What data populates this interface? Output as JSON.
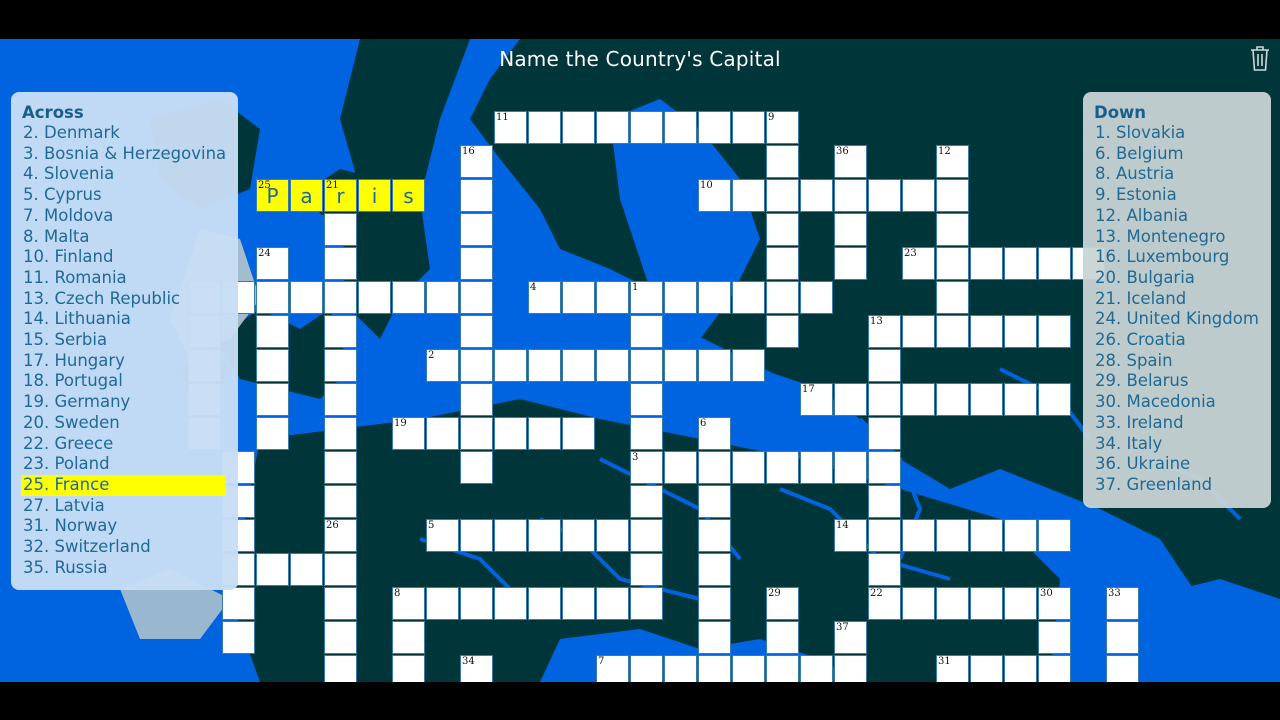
{
  "title": "Name the Country's Capital",
  "toolbar": {
    "trash_icon": "trash-icon"
  },
  "colors": {
    "sea": "#0063e0",
    "land": "#00353a",
    "highlight": "#ffff00",
    "clue_text": "#1f6a95"
  },
  "across": {
    "heading": "Across",
    "clues": [
      {
        "num": 2,
        "text": "2. Denmark"
      },
      {
        "num": 3,
        "text": "3. Bosnia & Herzegovina"
      },
      {
        "num": 4,
        "text": "4. Slovenia"
      },
      {
        "num": 5,
        "text": "5. Cyprus"
      },
      {
        "num": 7,
        "text": "7. Moldova"
      },
      {
        "num": 8,
        "text": "8. Malta"
      },
      {
        "num": 10,
        "text": "10. Finland"
      },
      {
        "num": 11,
        "text": "11. Romania"
      },
      {
        "num": 13,
        "text": "13. Czech Republic"
      },
      {
        "num": 14,
        "text": "14. Lithuania"
      },
      {
        "num": 15,
        "text": "15. Serbia"
      },
      {
        "num": 17,
        "text": "17. Hungary"
      },
      {
        "num": 18,
        "text": "18. Portugal"
      },
      {
        "num": 19,
        "text": "19. Germany"
      },
      {
        "num": 20,
        "text": "20. Sweden"
      },
      {
        "num": 22,
        "text": "22. Greece"
      },
      {
        "num": 23,
        "text": "23. Poland"
      },
      {
        "num": 25,
        "text": "25. France",
        "selected": true
      },
      {
        "num": 27,
        "text": "27. Latvia"
      },
      {
        "num": 31,
        "text": "31. Norway"
      },
      {
        "num": 32,
        "text": "32. Switzerland"
      },
      {
        "num": 35,
        "text": "35. Russia"
      }
    ]
  },
  "down": {
    "heading": "Down",
    "clues": [
      {
        "num": 1,
        "text": "1. Slovakia"
      },
      {
        "num": 6,
        "text": "6. Belgium"
      },
      {
        "num": 8,
        "text": "8. Austria"
      },
      {
        "num": 9,
        "text": "9. Estonia"
      },
      {
        "num": 12,
        "text": "12. Albania"
      },
      {
        "num": 13,
        "text": "13. Montenegro"
      },
      {
        "num": 16,
        "text": "16. Luxembourg"
      },
      {
        "num": 20,
        "text": "20. Bulgaria"
      },
      {
        "num": 21,
        "text": "21. Iceland"
      },
      {
        "num": 24,
        "text": "24. United Kingdom"
      },
      {
        "num": 26,
        "text": "26. Croatia"
      },
      {
        "num": 28,
        "text": "28. Spain"
      },
      {
        "num": 29,
        "text": "29. Belarus"
      },
      {
        "num": 30,
        "text": "30. Macedonia"
      },
      {
        "num": 33,
        "text": "33. Ireland"
      },
      {
        "num": 34,
        "text": "34. Italy"
      },
      {
        "num": 36,
        "text": "36. Ukraine"
      },
      {
        "num": 37,
        "text": "37. Greenland"
      }
    ]
  },
  "grid": {
    "entries": [
      {
        "num": 11,
        "dir": "across",
        "row": 0,
        "col": 9,
        "len": 9
      },
      {
        "num": 25,
        "dir": "across",
        "row": 2,
        "col": 2,
        "len": 5,
        "answer": "Paris",
        "selected": true
      },
      {
        "num": 10,
        "dir": "across",
        "row": 2,
        "col": 15,
        "len": 8
      },
      {
        "num": 23,
        "dir": "across",
        "row": 4,
        "col": 21,
        "len": 6
      },
      {
        "num": 20,
        "dir": "across",
        "row": 5,
        "col": 0,
        "len": 9
      },
      {
        "num": 4,
        "dir": "across",
        "row": 5,
        "col": 10,
        "len": 9
      },
      {
        "num": 13,
        "dir": "across",
        "row": 6,
        "col": 20,
        "len": 6
      },
      {
        "num": 2,
        "dir": "across",
        "row": 7,
        "col": 7,
        "len": 10
      },
      {
        "num": 17,
        "dir": "across",
        "row": 8,
        "col": 18,
        "len": 8
      },
      {
        "num": 19,
        "dir": "across",
        "row": 9,
        "col": 6,
        "len": 6
      },
      {
        "num": 3,
        "dir": "across",
        "row": 10,
        "col": 13,
        "len": 8
      },
      {
        "num": 5,
        "dir": "across",
        "row": 12,
        "col": 7,
        "len": 7
      },
      {
        "num": 14,
        "dir": "across",
        "row": 12,
        "col": 19,
        "len": 7
      },
      {
        "num": 27,
        "dir": "across",
        "row": 13,
        "col": 1,
        "len": 4
      },
      {
        "num": 8,
        "dir": "across",
        "row": 14,
        "col": 6,
        "len": 8
      },
      {
        "num": 22,
        "dir": "across",
        "row": 14,
        "col": 20,
        "len": 6
      },
      {
        "num": 7,
        "dir": "across",
        "row": 16,
        "col": 12,
        "len": 8
      },
      {
        "num": 31,
        "dir": "across",
        "row": 16,
        "col": 22,
        "len": 4
      },
      {
        "num": 9,
        "dir": "down",
        "row": 0,
        "col": 17,
        "len": 7
      },
      {
        "num": 16,
        "dir": "down",
        "row": 1,
        "col": 8,
        "len": 10
      },
      {
        "num": 36,
        "dir": "down",
        "row": 1,
        "col": 19,
        "len": 4
      },
      {
        "num": 12,
        "dir": "down",
        "row": 1,
        "col": 22,
        "len": 5
      },
      {
        "num": 21,
        "dir": "down",
        "row": 2,
        "col": 4,
        "len": 15
      },
      {
        "num": 24,
        "dir": "down",
        "row": 4,
        "col": 2,
        "len": 6
      },
      {
        "num": 20,
        "dir": "down",
        "row": 5,
        "col": 0,
        "len": 5
      },
      {
        "num": 1,
        "dir": "down",
        "row": 5,
        "col": 13,
        "len": 10
      },
      {
        "num": 13,
        "dir": "down",
        "row": 6,
        "col": 20,
        "len": 9
      },
      {
        "num": 6,
        "dir": "down",
        "row": 9,
        "col": 15,
        "len": 8
      },
      {
        "num": 28,
        "dir": "down",
        "row": 10,
        "col": 1,
        "len": 6
      },
      {
        "num": 26,
        "dir": "down",
        "row": 12,
        "col": 4,
        "len": 5
      },
      {
        "num": 8,
        "dir": "down",
        "row": 14,
        "col": 6,
        "len": 3
      },
      {
        "num": 29,
        "dir": "down",
        "row": 14,
        "col": 17,
        "len": 3
      },
      {
        "num": 30,
        "dir": "down",
        "row": 14,
        "col": 25,
        "len": 3
      },
      {
        "num": 33,
        "dir": "down",
        "row": 14,
        "col": 27,
        "len": 3
      },
      {
        "num": 37,
        "dir": "down",
        "row": 15,
        "col": 19,
        "len": 2
      },
      {
        "num": 34,
        "dir": "down",
        "row": 16,
        "col": 8,
        "len": 1
      }
    ]
  }
}
